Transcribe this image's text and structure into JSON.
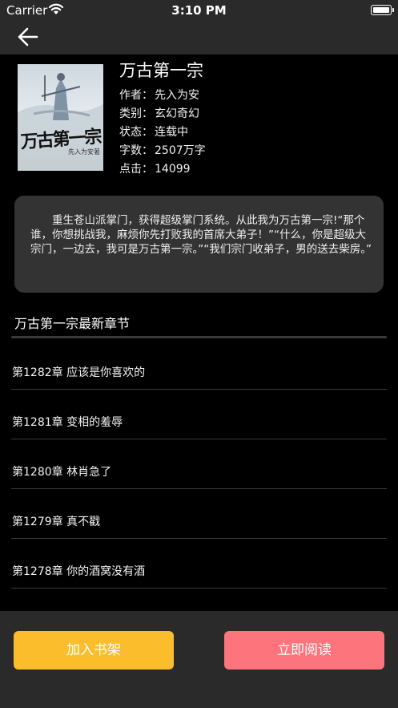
{
  "status_bar": {
    "carrier": "Carrier",
    "time": "3:10 PM"
  },
  "book": {
    "title": "万古第一宗",
    "cover_title": "万古第一宗",
    "cover_author": "先入为安著",
    "info": [
      {
        "label": "作者：",
        "value": "先入为安"
      },
      {
        "label": "类别：",
        "value": "玄幻奇幻"
      },
      {
        "label": "状态：",
        "value": "连载中"
      },
      {
        "label": "字数：",
        "value": "2507万字"
      },
      {
        "label": "点击：",
        "value": "14099"
      }
    ],
    "intro": "重生苍山派掌门，获得超级掌门系统。从此我为万古第一宗!“那个谁，你想挑战我，麻烦你先打败我的首席大弟子！”“什么，你是超级大宗门，一边去，我可是万古第一宗。”“我们宗门收弟子，男的送去柴房。”"
  },
  "chapters_section": {
    "title": "万古第一宗最新章节",
    "items": [
      "第1282章 应该是你喜欢的",
      "第1281章 变相的羞辱",
      "第1280章 林肖急了",
      "第1279章 真不戳",
      "第1278章 你的酒窝没有酒"
    ]
  },
  "actions": {
    "add_shelf": "加入书架",
    "read_now": "立即阅读"
  },
  "colors": {
    "shelf_button": "#fbbd2c",
    "read_button": "#fe747c",
    "bar_background": "#2a2a2a",
    "intro_background": "#333333"
  }
}
